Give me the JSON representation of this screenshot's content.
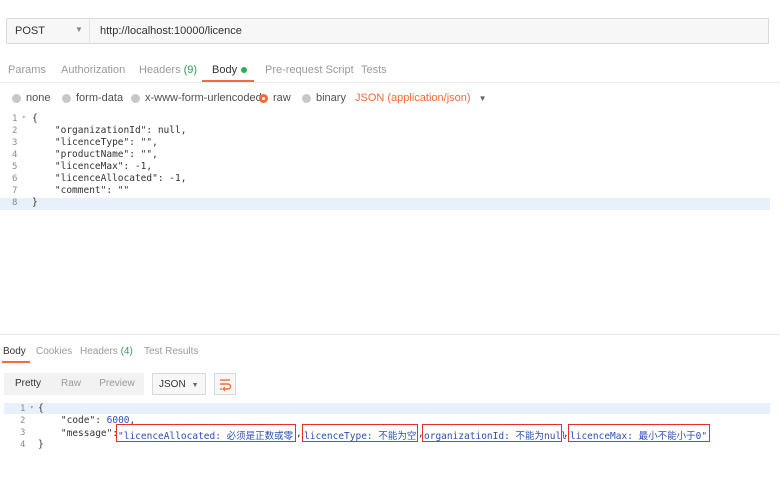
{
  "request": {
    "method": "POST",
    "url": "http://localhost:10000/licence"
  },
  "request_tabs": [
    {
      "label": "Params"
    },
    {
      "label": "Authorization"
    },
    {
      "label": "Headers",
      "count": "(9)"
    },
    {
      "label": "Body"
    },
    {
      "label": "Pre-request Script"
    },
    {
      "label": "Tests"
    }
  ],
  "body_types": [
    {
      "label": "none",
      "selected": false
    },
    {
      "label": "form-data",
      "selected": false
    },
    {
      "label": "x-www-form-urlencoded",
      "selected": false
    },
    {
      "label": "raw",
      "selected": true
    },
    {
      "label": "binary",
      "selected": false
    }
  ],
  "content_type": "JSON (application/json)",
  "request_body": {
    "line_numbers": [
      "1",
      "2",
      "3",
      "4",
      "5",
      "6",
      "7",
      "8"
    ],
    "lines": [
      "{",
      "    \"organizationId\": null,",
      "    \"licenceType\": \"\",",
      "    \"productName\": \"\",",
      "    \"licenceMax\": -1,",
      "    \"licenceAllocated\": -1,",
      "    \"comment\": \"\"",
      "}"
    ]
  },
  "response_tabs": [
    {
      "label": "Body"
    },
    {
      "label": "Cookies"
    },
    {
      "label": "Headers",
      "count": "(4)"
    },
    {
      "label": "Test Results"
    }
  ],
  "response_toolbar": {
    "pretty": "Pretty",
    "raw": "Raw",
    "preview": "Preview",
    "format": "JSON"
  },
  "response_body": {
    "line_numbers": [
      "1",
      "2",
      "3",
      "4"
    ],
    "line1": "{",
    "line2_key": "    \"code\": ",
    "line2_val": "6000",
    "line2_end": ",",
    "line3_key": "    \"message\": ",
    "msg_parts": [
      "\"licenceAllocated: 必须是正数或零",
      "licenceType: 不能为空",
      "organizationId: 不能为null",
      "licenceMax: 最小不能小于0\""
    ],
    "separator": ",",
    "line4": "}"
  },
  "colors": {
    "accent": "#f26b3a",
    "count_green": "#2e9e52",
    "highlight_red": "#e0312b"
  }
}
